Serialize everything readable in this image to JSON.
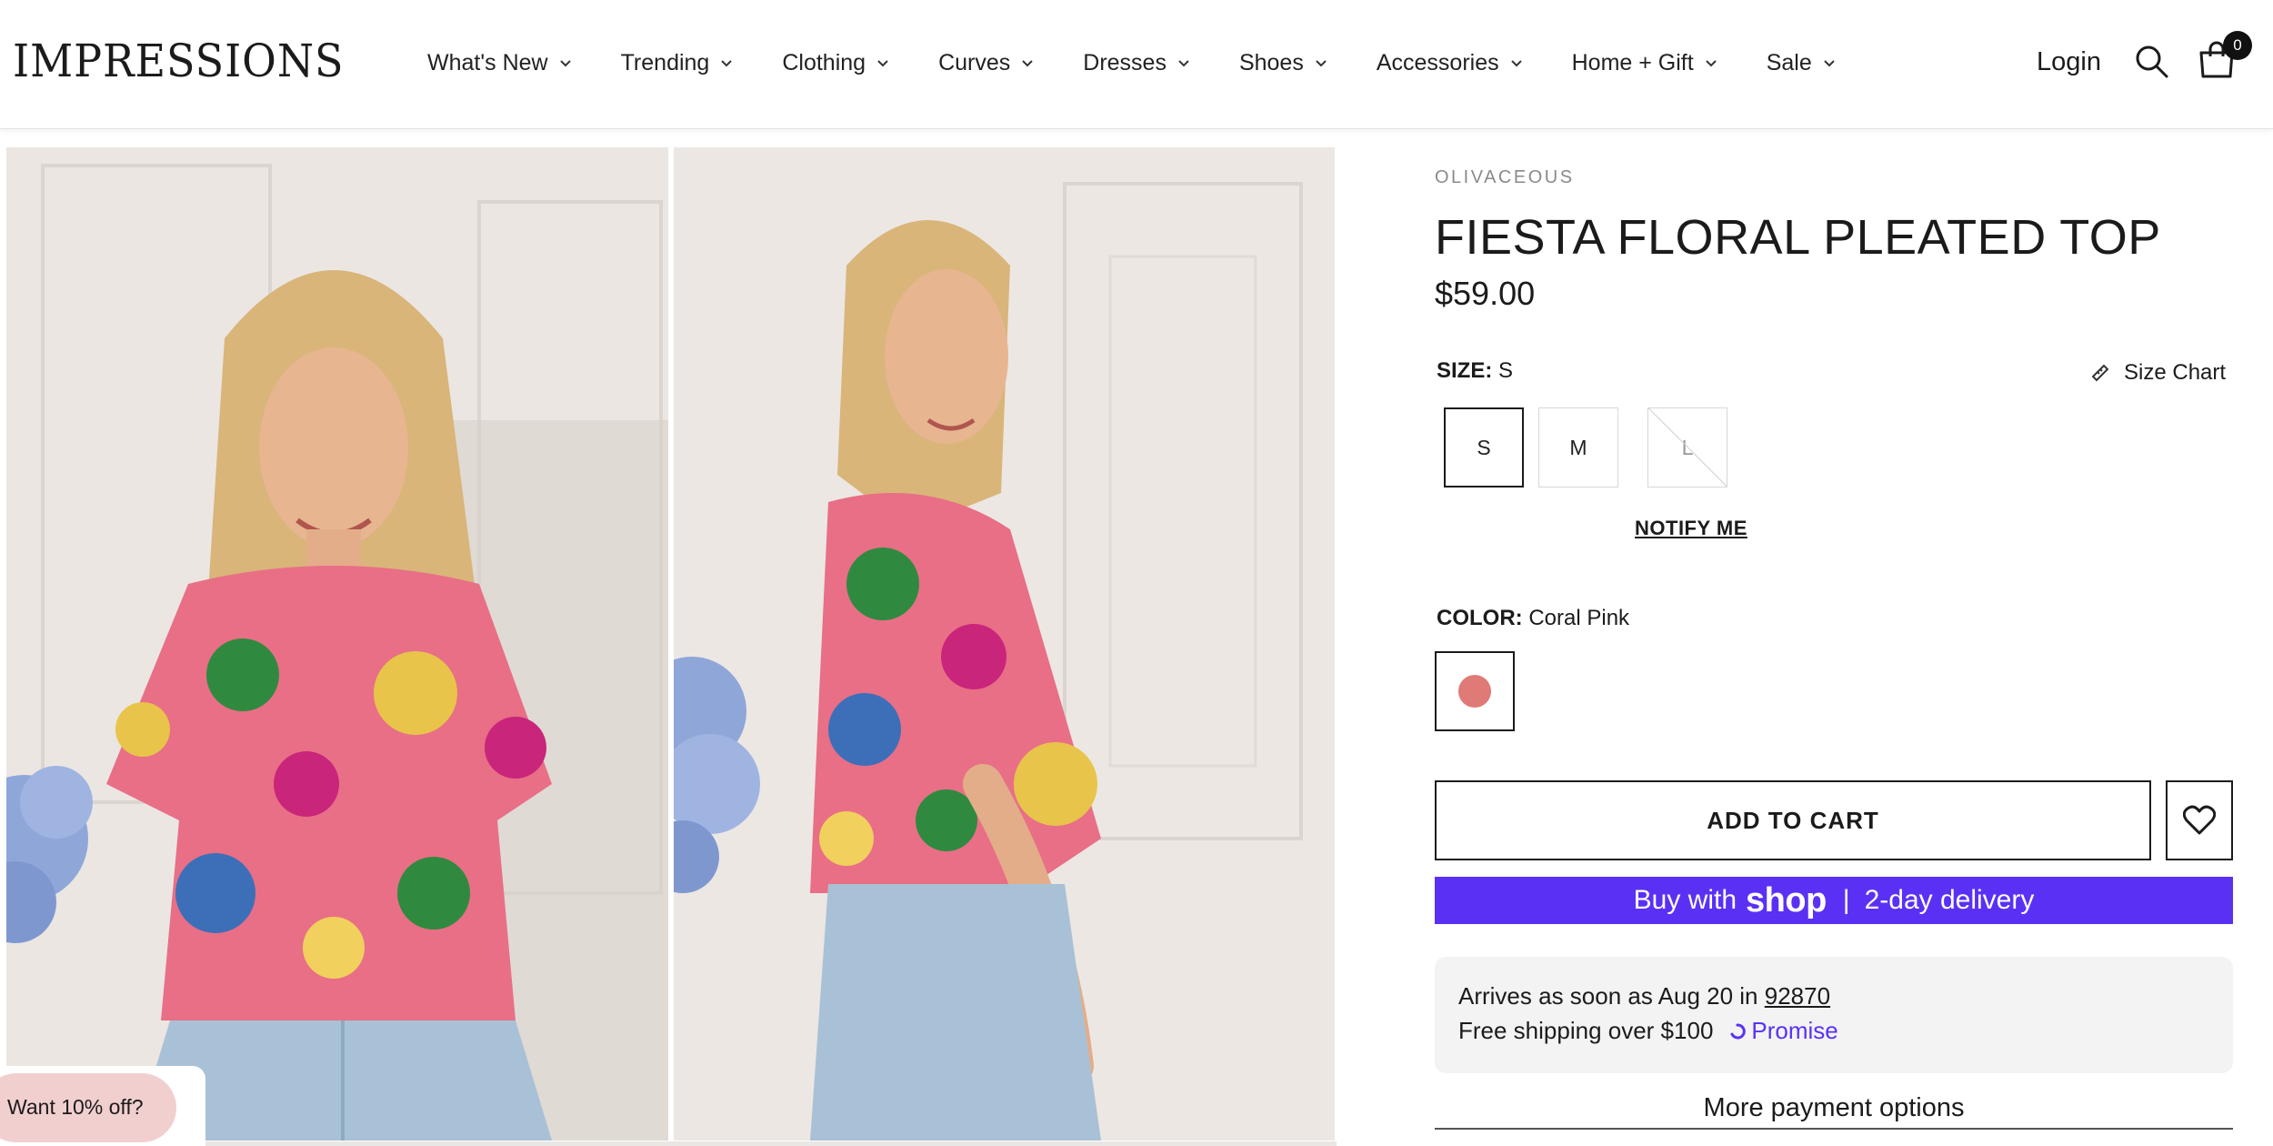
{
  "header": {
    "logo": "IMPRESSIONS",
    "nav": [
      {
        "label": "What's New"
      },
      {
        "label": "Trending"
      },
      {
        "label": "Clothing"
      },
      {
        "label": "Curves"
      },
      {
        "label": "Dresses"
      },
      {
        "label": "Shoes"
      },
      {
        "label": "Accessories"
      },
      {
        "label": "Home + Gift"
      },
      {
        "label": "Sale"
      }
    ],
    "login": "Login",
    "cart_count": "0",
    "icons": {
      "search": "search-icon",
      "cart": "shopping-bag-icon",
      "chevron": "chevron-down-icon"
    }
  },
  "promo": {
    "label": "Want 10% off?"
  },
  "product": {
    "vendor": "OLIVACEOUS",
    "title": "FIESTA FLORAL PLEATED TOP",
    "price": "$59.00",
    "size": {
      "label": "SIZE:",
      "selected": "S",
      "options": [
        "S",
        "M",
        "L"
      ],
      "sold_out": [
        "L"
      ],
      "size_chart": "Size Chart",
      "notify": "NOTIFY ME"
    },
    "color": {
      "label": "COLOR:",
      "selected": "Coral Pink",
      "swatch_hex": "#e07a76"
    },
    "add_to_cart": "ADD TO CART",
    "shop_pay": {
      "prefix": "Buy with",
      "brand": "shop",
      "divider": "|",
      "suffix": "2-day delivery",
      "color": "#5a31f4"
    },
    "delivery": {
      "arrives_prefix": "Arrives as soon as Aug 20 in",
      "zip": "92870",
      "free_shipping": "Free shipping over $100",
      "promise": "Promise"
    },
    "more_payment": "More payment options"
  }
}
